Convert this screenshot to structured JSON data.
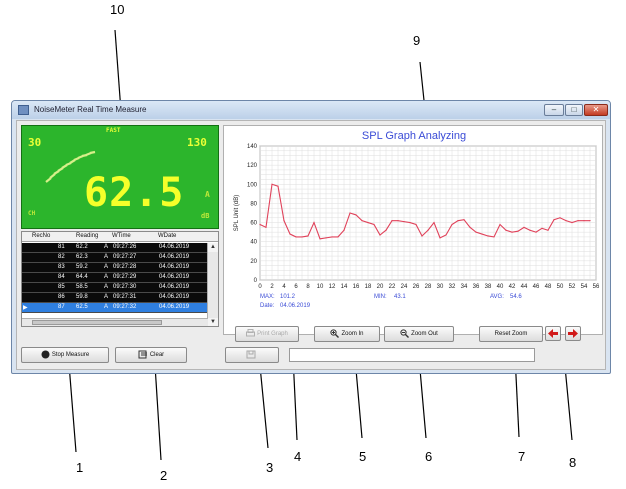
{
  "window": {
    "title": "NoiseMeter Real Time Measure",
    "minimize": "–",
    "maximize": "□",
    "close": "✕"
  },
  "lcd": {
    "mode": "FAST",
    "range_low": "30",
    "range_high": "130",
    "reading": "62.5",
    "weighting": "A",
    "unit": "dB",
    "flag": "CH"
  },
  "records": {
    "columns": [
      "RecNo",
      "Reading",
      "WTime",
      "WDate"
    ],
    "rows": [
      {
        "no": "81",
        "reading": "62.2",
        "w": "A",
        "time": "09:27:26",
        "date": "04.06.2019"
      },
      {
        "no": "82",
        "reading": "62.3",
        "w": "A",
        "time": "09:27:27",
        "date": "04.06.2019"
      },
      {
        "no": "83",
        "reading": "59.2",
        "w": "A",
        "time": "09:27:28",
        "date": "04.06.2019"
      },
      {
        "no": "84",
        "reading": "64.4",
        "w": "A",
        "time": "09:27:29",
        "date": "04.06.2019"
      },
      {
        "no": "85",
        "reading": "58.5",
        "w": "A",
        "time": "09:27:30",
        "date": "04.06.2019"
      },
      {
        "no": "86",
        "reading": "59.8",
        "w": "A",
        "time": "09:27:31",
        "date": "04.06.2019"
      },
      {
        "no": "87",
        "reading": "62.5",
        "w": "A",
        "time": "09:27:32",
        "date": "04.06.2019"
      }
    ],
    "selected_index": 6
  },
  "graph": {
    "title": "SPL Graph Analyzing",
    "max_label": "MAX:",
    "max_value": "101.2",
    "min_label": "MIN:",
    "min_value": "43.1",
    "avg_label": "AVG:",
    "avg_value": "54.6",
    "date_label": "Date:",
    "date_value": "04.06.2019"
  },
  "chart_data": {
    "type": "line",
    "title": "SPL Graph Analyzing",
    "xlabel": "",
    "ylabel": "SPL Unit (dB)",
    "xlim": [
      0,
      56
    ],
    "ylim": [
      0,
      140
    ],
    "xticks": [
      0,
      2,
      4,
      6,
      8,
      10,
      12,
      14,
      16,
      18,
      20,
      22,
      24,
      26,
      28,
      30,
      32,
      34,
      36,
      38,
      40,
      42,
      44,
      46,
      48,
      50,
      52,
      54,
      56
    ],
    "yticks": [
      0,
      20,
      40,
      60,
      80,
      100,
      120,
      140
    ],
    "grid": true,
    "color": "#e0425a",
    "series": [
      {
        "x": [
          0,
          1,
          2,
          3,
          4,
          5,
          6,
          7,
          8,
          9,
          10,
          11,
          12,
          13,
          14,
          15,
          16,
          17,
          18,
          19,
          20,
          21,
          22,
          23,
          24,
          25,
          26,
          27,
          28,
          29,
          30,
          31,
          32,
          33,
          34,
          35,
          36,
          37,
          38,
          39,
          40,
          41,
          42,
          43,
          44,
          45,
          46,
          47,
          48,
          49,
          50,
          51,
          52,
          53,
          54,
          55
        ],
        "values": [
          58,
          55,
          100,
          98,
          62,
          48,
          45,
          45,
          46,
          60,
          43,
          44,
          45,
          45,
          52,
          70,
          68,
          62,
          60,
          58,
          47,
          52,
          62,
          62,
          61,
          60,
          58,
          46,
          52,
          60,
          44,
          47,
          58,
          62,
          63,
          55,
          50,
          48,
          46,
          45,
          58,
          52,
          50,
          51,
          55,
          52,
          50,
          54,
          52,
          63,
          65,
          62,
          60,
          62,
          62,
          62
        ]
      }
    ]
  },
  "buttons": {
    "print_graph": "Print Graph",
    "zoom_in": "Zoom In",
    "zoom_out": "Zoom Out",
    "reset_zoom": "Reset Zoom",
    "stop_measure": "Stop Measure",
    "clear": "Clear"
  },
  "callouts": [
    "1",
    "2",
    "3",
    "4",
    "5",
    "6",
    "7",
    "8",
    "9",
    "10"
  ]
}
